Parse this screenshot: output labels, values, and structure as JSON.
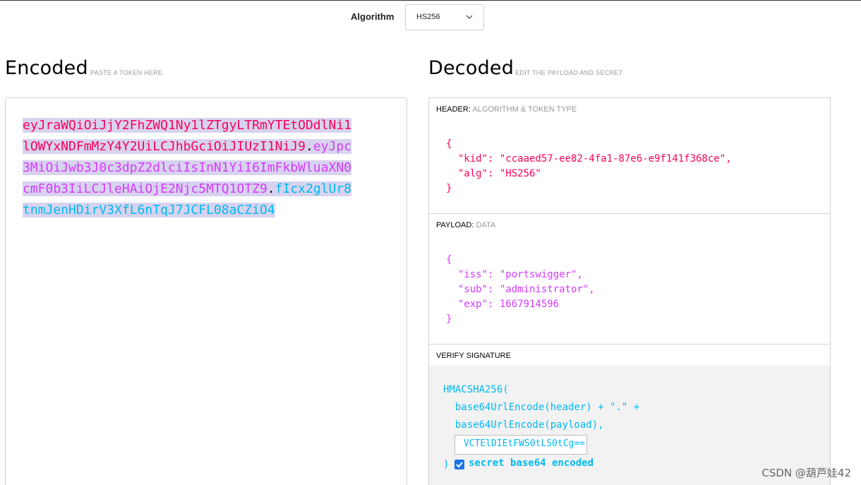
{
  "algorithm": {
    "label": "Algorithm",
    "selected": "HS256"
  },
  "encoded": {
    "title": "Encoded",
    "subtitle": "PASTE A TOKEN HERE",
    "token_header": "eyJraWQiOiJjY2FhZWQ1Ny1lZTgyLTRmYTEtODdlNi1lOWYxNDFmMzY4Y2UiLCJhbGciOiJIUzI1NiJ9",
    "dot1": ".",
    "token_payload": "eyJpc3MiOiJwb3J0c3dpZ2dlciIsInN1YiI6ImFkbWluaXN0cmF0b3IiLCJleHAiOjE2Njc5MTQ1OTZ9",
    "dot2": ".",
    "token_signature": "fIcx2glUr8tnmJenHDirV3XfL6nTqJ7JCFL08aCZiO4"
  },
  "decoded": {
    "title": "Decoded",
    "subtitle": "EDIT THE PAYLOAD AND SECRET",
    "header_section": {
      "label": "HEADER:",
      "desc": "ALGORITHM & TOKEN TYPE"
    },
    "header_lines": [
      "{",
      "  \"kid\": \"ccaaed57-ee82-4fa1-87e6-e9f141f368ce\",",
      "  \"alg\": \"HS256\"",
      "}"
    ],
    "payload_section": {
      "label": "PAYLOAD:",
      "desc": "DATA"
    },
    "payload_lines": [
      "{",
      "  \"iss\": \"portswigger\",",
      "  \"sub\": \"administrator\",",
      "  \"exp\": 1667914596",
      "}"
    ],
    "verify_section": {
      "label": "VERIFY SIGNATURE"
    },
    "verify_lines": [
      "HMACSHA256(",
      "  base64UrlEncode(header) + \".\" +",
      "  base64UrlEncode(payload),"
    ],
    "secret_value": "VCTElDIEtFWS0tLS0tCg==",
    "close_paren": ")",
    "secret_checkbox_label": "secret base64 encoded"
  },
  "watermark": "CSDN @葫芦娃42",
  "icons": {
    "select_chevron": "chevron-down-icon",
    "checkbox_check": "check-icon"
  }
}
